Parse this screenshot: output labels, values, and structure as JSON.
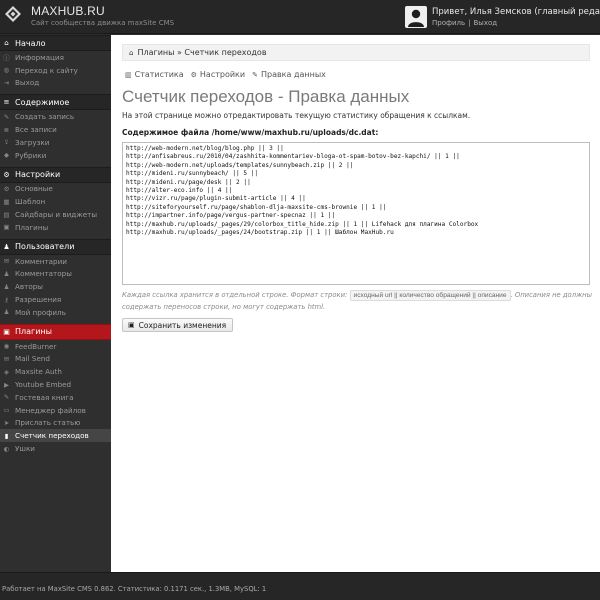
{
  "header": {
    "site_name": "MAXHUB.RU",
    "site_desc": "Сайт сообщества движка maxSite CMS",
    "greeting": "Привет, Илья Земсков (главный редактор)!",
    "profile_link": "Профиль",
    "separator": "|",
    "logout_link": "Выход"
  },
  "sidebar": {
    "sections": [
      {
        "title": "Начало",
        "icon": "home-icon",
        "glyph": "⌂",
        "active": false,
        "items": [
          {
            "label": "Информация",
            "icon": "info-icon",
            "glyph": "ⓘ"
          },
          {
            "label": "Переход к сайту",
            "icon": "globe-icon",
            "glyph": "◍"
          },
          {
            "label": "Выход",
            "icon": "exit-icon",
            "glyph": "⇥"
          }
        ]
      },
      {
        "title": "Содержимое",
        "icon": "list-icon",
        "glyph": "≡",
        "active": false,
        "items": [
          {
            "label": "Создать запись",
            "icon": "pencil-icon",
            "glyph": "✎"
          },
          {
            "label": "Все записи",
            "icon": "list-icon",
            "glyph": "≣"
          },
          {
            "label": "Загрузки",
            "icon": "upload-icon",
            "glyph": "⇪"
          },
          {
            "label": "Рубрики",
            "icon": "tag-icon",
            "glyph": "◆"
          }
        ]
      },
      {
        "title": "Настройки",
        "icon": "gear-icon",
        "glyph": "⚙",
        "active": false,
        "items": [
          {
            "label": "Основные",
            "icon": "gear-icon",
            "glyph": "⚙"
          },
          {
            "label": "Шаблон",
            "icon": "template-icon",
            "glyph": "▦"
          },
          {
            "label": "Сайдбары и виджеты",
            "icon": "widgets-icon",
            "glyph": "▤"
          },
          {
            "label": "Плагины",
            "icon": "plugin-icon",
            "glyph": "▣"
          }
        ]
      },
      {
        "title": "Пользователи",
        "icon": "user-icon",
        "glyph": "♟",
        "active": false,
        "items": [
          {
            "label": "Комментарии",
            "icon": "comment-icon",
            "glyph": "✉"
          },
          {
            "label": "Комментаторы",
            "icon": "commenters-icon",
            "glyph": "♟"
          },
          {
            "label": "Авторы",
            "icon": "authors-icon",
            "glyph": "♟"
          },
          {
            "label": "Разрешения",
            "icon": "key-icon",
            "glyph": "⚷"
          },
          {
            "label": "Мой профиль",
            "icon": "profile-icon",
            "glyph": "♟"
          }
        ]
      },
      {
        "title": "Плагины",
        "icon": "plugin-icon",
        "glyph": "▣",
        "active": true,
        "items": [
          {
            "label": "FeedBurner",
            "icon": "feed-icon",
            "glyph": "◉"
          },
          {
            "label": "Mail Send",
            "icon": "mail-icon",
            "glyph": "✉"
          },
          {
            "label": "Maxsite Auth",
            "icon": "auth-icon",
            "glyph": "◈"
          },
          {
            "label": "Youtube Embed",
            "icon": "video-icon",
            "glyph": "▶"
          },
          {
            "label": "Гостевая книга",
            "icon": "guestbook-icon",
            "glyph": "✎"
          },
          {
            "label": "Менеджер файлов",
            "icon": "folder-icon",
            "glyph": "▭"
          },
          {
            "label": "Прислать статью",
            "icon": "send-icon",
            "glyph": "➤"
          },
          {
            "label": "Счетчик переходов",
            "icon": "counter-icon",
            "glyph": "▮",
            "current": true
          },
          {
            "label": "Ушки",
            "icon": "ears-icon",
            "glyph": "◐"
          }
        ]
      }
    ]
  },
  "breadcrumb": {
    "text": "Плагины » Счетчик переходов"
  },
  "tabs": [
    {
      "label": "Статистика",
      "icon": "chart-icon",
      "glyph": "▥"
    },
    {
      "label": "Настройки",
      "icon": "gear-icon",
      "glyph": "⚙"
    },
    {
      "label": "Правка данных",
      "icon": "edit-icon",
      "glyph": "✎"
    }
  ],
  "main": {
    "title": "Счетчик переходов - Правка данных",
    "description": "На этой странице можно отредактировать текущую статистику обращения к ссылкам.",
    "file_label": "Содержимое файла /home/www/maxhub.ru/uploads/dc.dat:",
    "file_lines": [
      "http://web-modern.net/blog/blog.php || 3 ||",
      "http://anfisabreus.ru/2010/04/zashhita-kommentariev-bloga-ot-spam-botov-bez-kapchi/ || 1 ||",
      "http://web-modern.net/uploads/templates/sunnybeach.zip || 2 ||",
      "http://mideni.ru/sunnybeach/ || 5 ||",
      "http://mideni.ru/page/desk || 2 ||",
      "http://alter-eco.info || 4 ||",
      "http://vizr.ru/page/plugin-submit-article || 4 ||",
      "http://siteforyourself.ru/page/shablon-dlja-maxsite-cms-brownie || 1 ||",
      "http://impartner.info/page/vergus-partner-specnaz || 1 ||",
      "http://maxhub.ru/uploads/_pages/29/colorbox_title_hide.zip || 1 || Lifehack для плагина Colorbox",
      "http://maxhub.ru/uploads/_pages/24/bootstrap.zip || 1 || Шаблон MaxHub.ru"
    ],
    "note_before": "Каждая ссылка хранится в отдельной строке. Формат строки: ",
    "note_code": "исходный url || количество обращений || описание",
    "note_after": ". Описания не должны содержать переносов строки, но могут содержать html.",
    "save_label": "Сохранить изменения"
  },
  "footer": {
    "text": "Работает на MaxSite CMS 0.862. Статистика: 0.1171 сек., 1.3MB, MySQL: 1"
  }
}
